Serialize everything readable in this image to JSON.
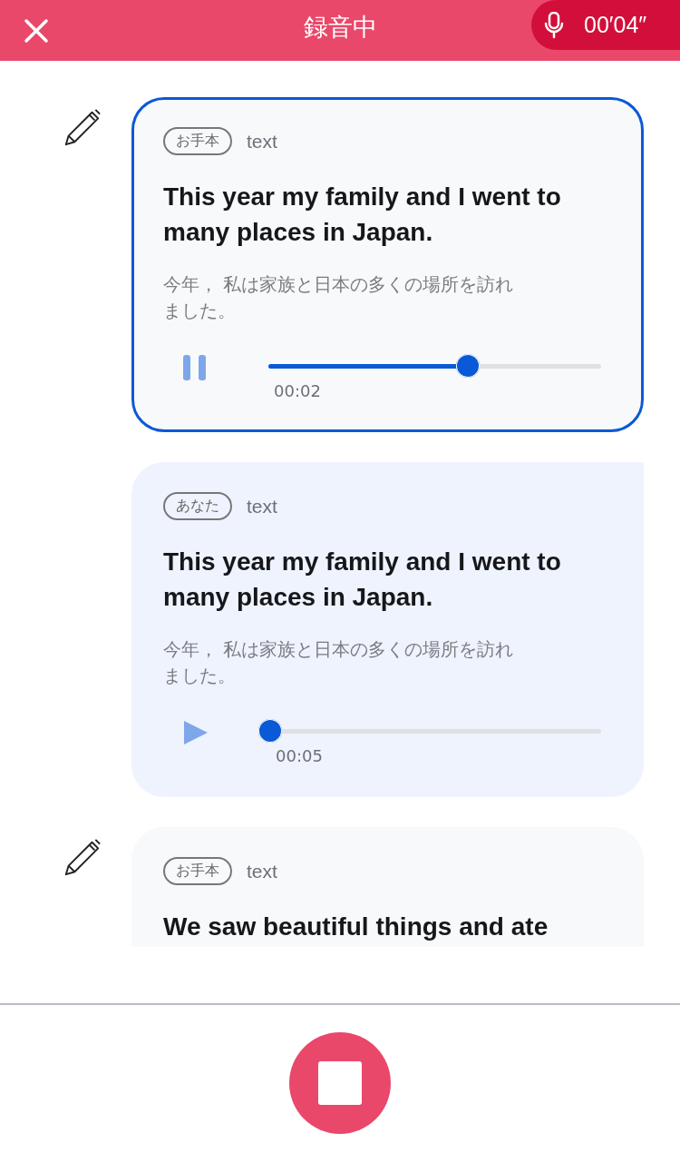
{
  "header": {
    "title": "録音中",
    "timer": "00′04″"
  },
  "cards": [
    {
      "kind": "model",
      "editable": true,
      "selected": true,
      "playing": true,
      "tag": "お手本",
      "label": "text",
      "title": "This year my family and I went to many places in Japan.",
      "translation": "今年， 私は家族と日本の多くの場所を訪れました。",
      "level": 0.56,
      "time": "00:02"
    },
    {
      "kind": "user",
      "editable": false,
      "selected": false,
      "playing": false,
      "tag": "あなた",
      "label": "text",
      "title": "This year my family and I went to many places in Japan.",
      "translation": "今年， 私は家族と日本の多くの場所を訪れました。",
      "level": 0,
      "time": "00:05"
    },
    {
      "kind": "model",
      "editable": true,
      "selected": false,
      "tag": "お手本",
      "label": "text",
      "title": "We saw beautiful things and ate"
    }
  ]
}
